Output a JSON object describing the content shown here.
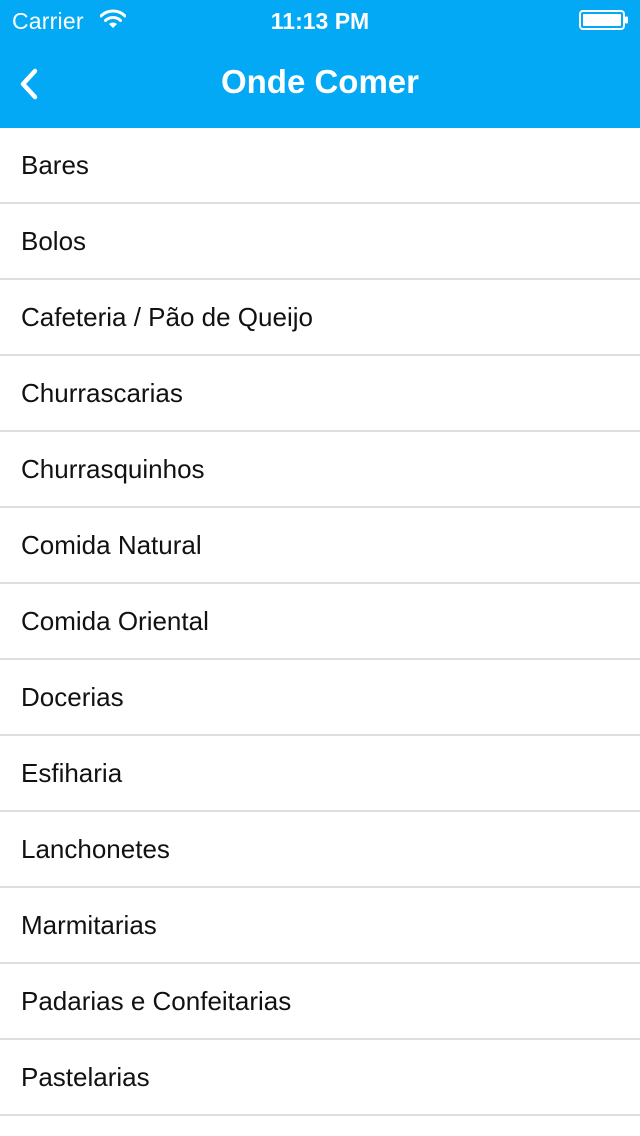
{
  "colors": {
    "accent": "#03A9F4",
    "header_text": "#ffffff",
    "separator": "#dedede",
    "item_text": "#111111"
  },
  "status_bar": {
    "carrier": "Carrier",
    "time": "11:13 PM",
    "icons": [
      "wifi-icon",
      "battery-icon"
    ]
  },
  "nav": {
    "back_icon": "chevron-left-icon",
    "title": "Onde Comer"
  },
  "categories": [
    {
      "label": "Bares"
    },
    {
      "label": "Bolos"
    },
    {
      "label": "Cafeteria / Pão de Queijo"
    },
    {
      "label": "Churrascarias"
    },
    {
      "label": "Churrasquinhos"
    },
    {
      "label": "Comida Natural"
    },
    {
      "label": "Comida Oriental"
    },
    {
      "label": "Docerias"
    },
    {
      "label": "Esfiharia"
    },
    {
      "label": "Lanchonetes"
    },
    {
      "label": "Marmitarias"
    },
    {
      "label": "Padarias e Confeitarias"
    },
    {
      "label": "Pastelarias"
    }
  ]
}
